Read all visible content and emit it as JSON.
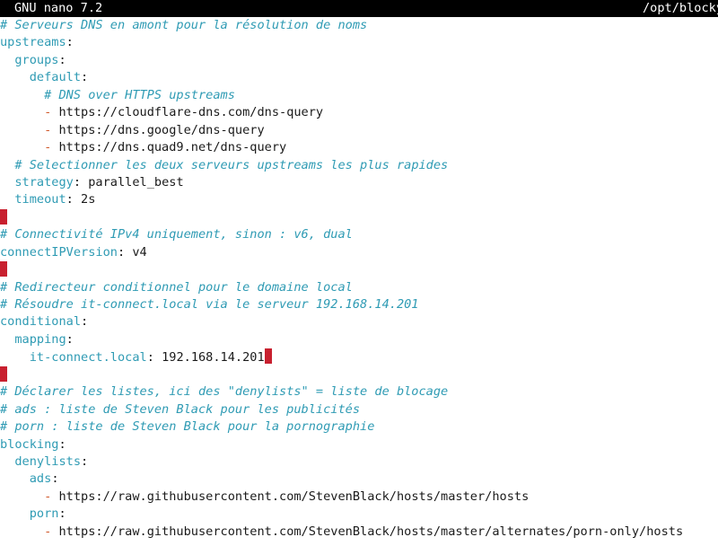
{
  "titlebar": {
    "app": "GNU nano 7.2",
    "path": "/opt/blocky"
  },
  "lines": {
    "l1": "# Serveurs DNS en amont pour la résolution de noms",
    "l2_key": "upstreams",
    "l3_key": "groups",
    "l4_key": "default",
    "l5": "# DNS over HTTPS upstreams",
    "l6_val": "https://cloudflare-dns.com/dns-query",
    "l7_val": "https://dns.google/dns-query",
    "l8_val": "https://dns.quad9.net/dns-query",
    "l9": "# Selectionner les deux serveurs upstreams les plus rapides",
    "l10_key": "strategy",
    "l10_val": "parallel_best",
    "l11_key": "timeout",
    "l11_val": "2s",
    "l13": "# Connectivité IPv4 uniquement, sinon : v6, dual",
    "l14_key": "connectIPVersion",
    "l14_val": "v4",
    "l16": "# Redirecteur conditionnel pour le domaine local",
    "l17": "# Résoudre it-connect.local via le serveur 192.168.14.201",
    "l18_key": "conditional",
    "l19_key": "mapping",
    "l20_key": "it-connect.local",
    "l20_val": "192.168.14.201",
    "l22": "# Déclarer les listes, ici des \"denylists\" = liste de blocage",
    "l23": "# ads : liste de Steven Black pour les publicités",
    "l24": "# porn : liste de Steven Black pour la pornographie",
    "l25_key": "blocking",
    "l26_key": "denylists",
    "l27_key": "ads",
    "l28_val": "https://raw.githubusercontent.com/StevenBlack/hosts/master/hosts",
    "l29_key": "porn",
    "l30_val": "https://raw.githubusercontent.com/StevenBlack/hosts/master/alternates/porn-only/hosts"
  },
  "colors": {
    "comment": "#2f9bb4",
    "key": "#2f9bb4",
    "value": "#1a1a1a",
    "dash": "#d0582a",
    "marker": "#c8202f",
    "titlebar_bg": "#000000"
  }
}
